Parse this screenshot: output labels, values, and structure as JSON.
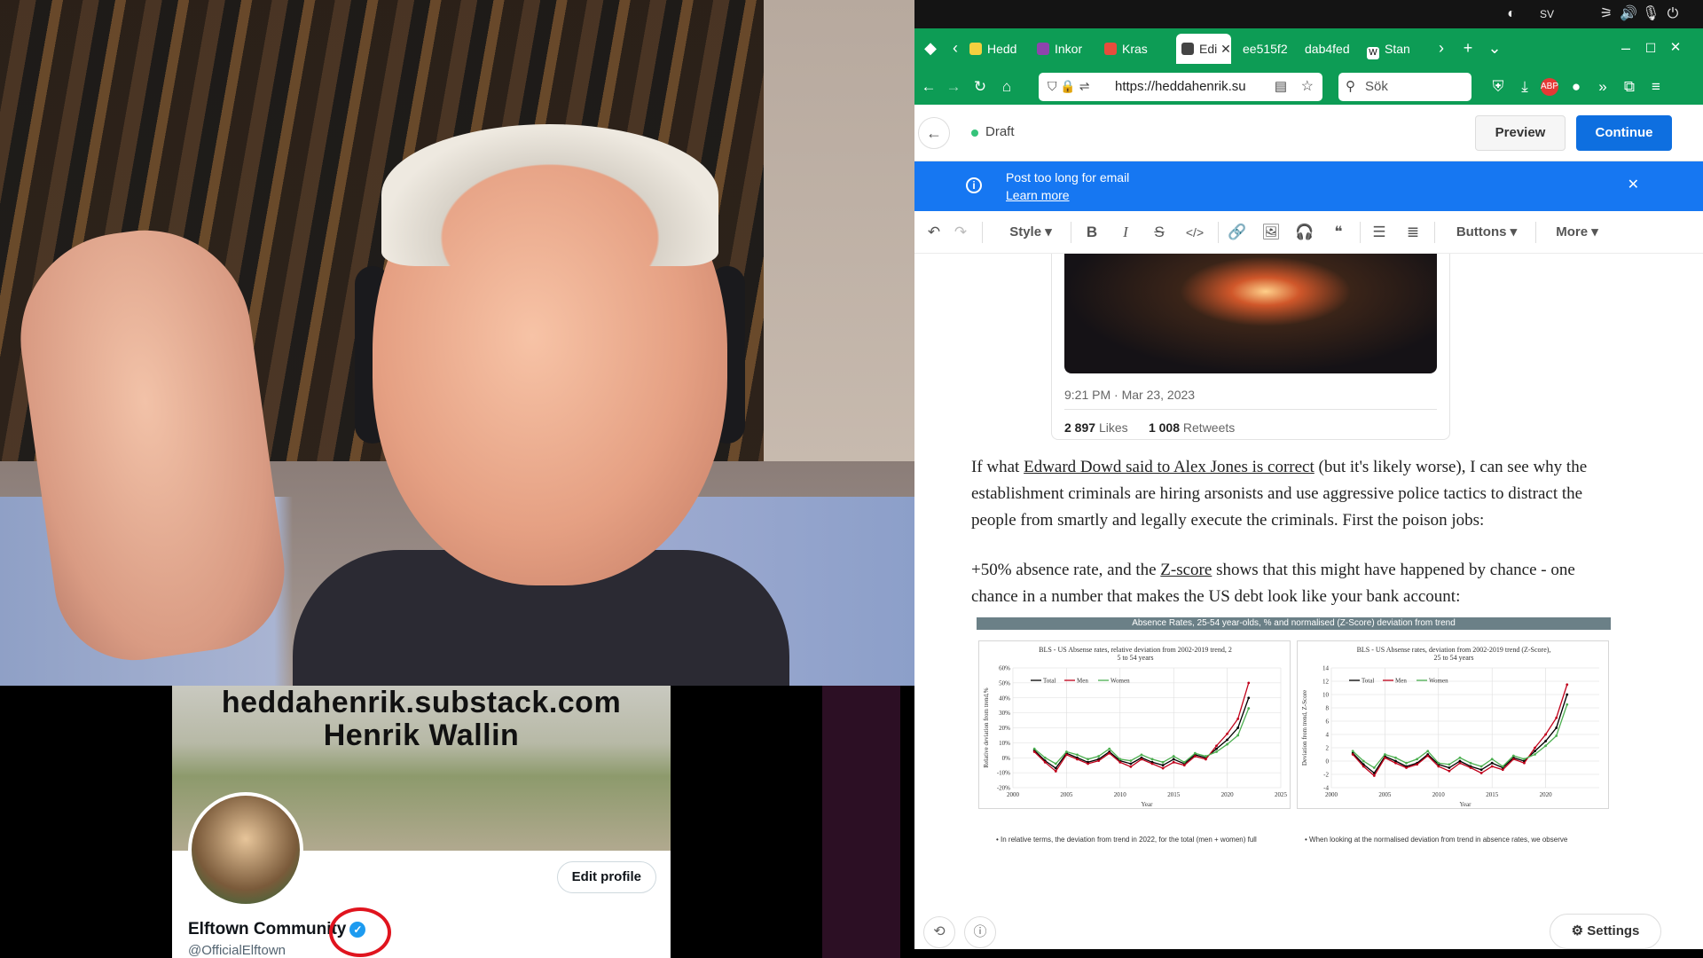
{
  "system": {
    "indicator": "SV",
    "icons": [
      "ubuntu-icon",
      "network-icon",
      "volume-icon",
      "mic-icon",
      "power-icon"
    ]
  },
  "browser": {
    "tabs": [
      {
        "label": "Hedd",
        "favicon_color": "#f4d03f"
      },
      {
        "label": "Inkor",
        "favicon_color": "#8e44ad"
      },
      {
        "label": "Kras",
        "favicon_color": "#e74c3c"
      },
      {
        "label": "Edi",
        "favicon_color": "#444444"
      },
      {
        "label": "ee515f2",
        "favicon_color": ""
      },
      {
        "label": "dab4fed",
        "favicon_color": ""
      },
      {
        "label": "Stan",
        "favicon_color": "#ffffff"
      }
    ],
    "url": "https://heddahenrik.su",
    "search_placeholder": "Sök"
  },
  "editor": {
    "status": "Draft",
    "preview_label": "Preview",
    "continue_label": "Continue",
    "banner_message": "Post too long for email",
    "banner_link": "Learn more",
    "toolbar": {
      "style_label": "Style",
      "buttons_label": "Buttons",
      "more_label": "More"
    },
    "tweet": {
      "time": "9:21 PM · Mar 23, 2023",
      "likes_count": "2 897",
      "likes_label": "Likes",
      "retweets_count": "1 008",
      "retweets_label": "Retweets"
    },
    "paragraph1": {
      "before": "If what ",
      "link": "Edward Dowd said to Alex Jones  is correct",
      "after": " (but it's likely worse), I can see why the establishment criminals are hiring arsonists and use aggressive police tactics to distract the people from smartly and legally execute the criminals. First the poison jobs:"
    },
    "paragraph2": {
      "before": "+50% absence rate, and the ",
      "link": "Z-score",
      "after": " shows that this might have happened by chance - one chance in a number that makes the US debt look like your bank account:"
    },
    "settings_label": "Settings"
  },
  "chart_data": [
    {
      "type": "line",
      "title": "BLS - US Absense rates, relative deviation from 2002-2019 trend, 25 to 54 years",
      "xlabel": "Year",
      "ylabel": "Relative deviation from trend,%",
      "xlim": [
        2000,
        2025
      ],
      "ylim": [
        -20,
        60
      ],
      "yticks": [
        "60%",
        "50%",
        "40%",
        "30%",
        "20%",
        "10%",
        "0%",
        "-10%",
        "-20%"
      ],
      "xticks": [
        "2000",
        "2005",
        "2010",
        "2015",
        "2020",
        "2025"
      ],
      "legend": "top-left",
      "x": [
        2002,
        2003,
        2004,
        2005,
        2006,
        2007,
        2008,
        2009,
        2010,
        2011,
        2012,
        2013,
        2014,
        2015,
        2016,
        2017,
        2018,
        2019,
        2020,
        2021,
        2022
      ],
      "series": [
        {
          "name": "Total",
          "color": "#000000",
          "values": [
            5,
            -2,
            -7,
            3,
            0,
            -3,
            -1,
            4,
            -2,
            -4,
            0,
            -3,
            -5,
            -1,
            -4,
            2,
            0,
            6,
            12,
            20,
            40
          ]
        },
        {
          "name": "Men",
          "color": "#c0001a",
          "values": [
            4,
            -3,
            -9,
            2,
            -1,
            -4,
            -2,
            3,
            -3,
            -6,
            -1,
            -4,
            -7,
            -3,
            -5,
            1,
            -1,
            8,
            16,
            26,
            50
          ]
        },
        {
          "name": "Women",
          "color": "#4caf50",
          "values": [
            6,
            0,
            -4,
            4,
            2,
            -1,
            1,
            6,
            -1,
            -2,
            2,
            -1,
            -3,
            1,
            -3,
            3,
            1,
            4,
            9,
            15,
            33
          ]
        }
      ]
    },
    {
      "type": "line",
      "title": "BLS - US Absense rates, deviation from 2002-2019 trend (Z-Score), 25 to 54 years",
      "xlabel": "Year",
      "ylabel": "Deviation from trend, Z-Score",
      "xlim": [
        2000,
        2025
      ],
      "ylim": [
        -4,
        14
      ],
      "yticks": [
        "14",
        "12",
        "10",
        "8",
        "6",
        "4",
        "2",
        "0",
        "-2",
        "-4"
      ],
      "xticks": [
        "2000",
        "2005",
        "2010",
        "2015",
        "2020"
      ],
      "legend": "top-left",
      "x": [
        2002,
        2003,
        2004,
        2005,
        2006,
        2007,
        2008,
        2009,
        2010,
        2011,
        2012,
        2013,
        2014,
        2015,
        2016,
        2017,
        2018,
        2019,
        2020,
        2021,
        2022
      ],
      "series": [
        {
          "name": "Total",
          "color": "#000000",
          "values": [
            1.2,
            -0.5,
            -1.8,
            0.7,
            0,
            -0.8,
            -0.3,
            1,
            -0.5,
            -1,
            0,
            -0.8,
            -1.3,
            -0.3,
            -1,
            0.5,
            0,
            1.5,
            3,
            5,
            10
          ]
        },
        {
          "name": "Men",
          "color": "#c0001a",
          "values": [
            1,
            -0.8,
            -2.2,
            0.5,
            -0.3,
            -1,
            -0.5,
            0.8,
            -0.8,
            -1.5,
            -0.3,
            -1,
            -1.8,
            -0.8,
            -1.3,
            0.3,
            -0.3,
            2,
            4,
            6.5,
            11.5
          ]
        },
        {
          "name": "Women",
          "color": "#4caf50",
          "values": [
            1.5,
            0,
            -1,
            1,
            0.5,
            -0.3,
            0.3,
            1.5,
            -0.3,
            -0.5,
            0.5,
            -0.3,
            -0.8,
            0.3,
            -0.8,
            0.8,
            0.3,
            1,
            2.3,
            3.8,
            8.5
          ]
        }
      ]
    }
  ],
  "chart_panel": {
    "header": "Absence Rates, 25-54 year-olds, % and normalised (Z-Score) deviation from trend",
    "bullet_left": "In relative terms, the deviation from trend in 2022, for the total (men + women) full",
    "bullet_right": "When looking at the normalised deviation from trend in absence rates, we observe"
  },
  "twitter": {
    "banner_line1": "heddahenrik.substack.com",
    "banner_line2": "Henrik Wallin",
    "name": "Elftown Community",
    "handle": "@OfficialElftown",
    "edit_label": "Edit profile"
  }
}
